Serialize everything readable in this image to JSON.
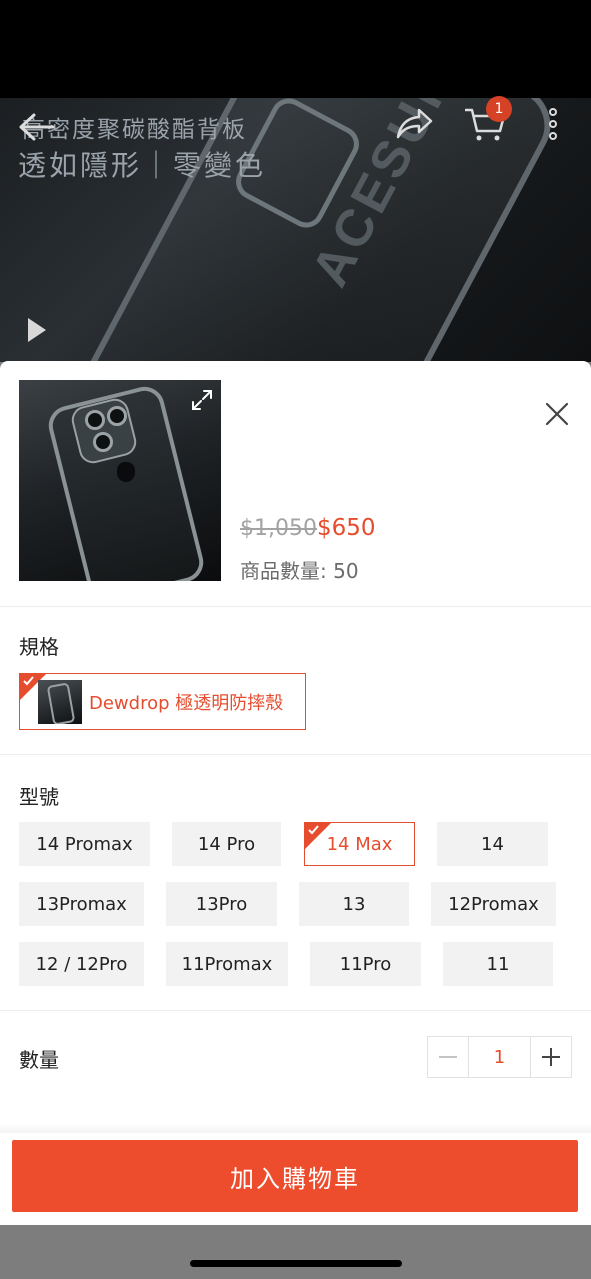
{
  "hero": {
    "line1": "高密度聚碳酸酯背板",
    "line2": "透如隱形｜零變色",
    "cart_count": "1"
  },
  "product": {
    "price_original": "$1,050",
    "price_current": "$650",
    "stock_label": "商品數量: 50"
  },
  "spec": {
    "title": "規格",
    "options": [
      {
        "label": "Dewdrop 極透明防摔殼",
        "selected": true
      }
    ]
  },
  "model": {
    "title": "型號",
    "options": [
      {
        "label": "14 Promax"
      },
      {
        "label": "14 Pro"
      },
      {
        "label": "14 Max",
        "selected": true
      },
      {
        "label": "14"
      },
      {
        "label": "13Promax"
      },
      {
        "label": "13Pro"
      },
      {
        "label": "13"
      },
      {
        "label": "12Promax"
      },
      {
        "label": "12 / 12Pro"
      },
      {
        "label": "11Promax"
      },
      {
        "label": "11Pro"
      },
      {
        "label": "11"
      }
    ]
  },
  "quantity": {
    "title": "數量",
    "value": "1"
  },
  "actions": {
    "add_to_cart": "加入購物車"
  },
  "colors": {
    "accent": "#ee4d2d",
    "badge": "#d64226"
  }
}
